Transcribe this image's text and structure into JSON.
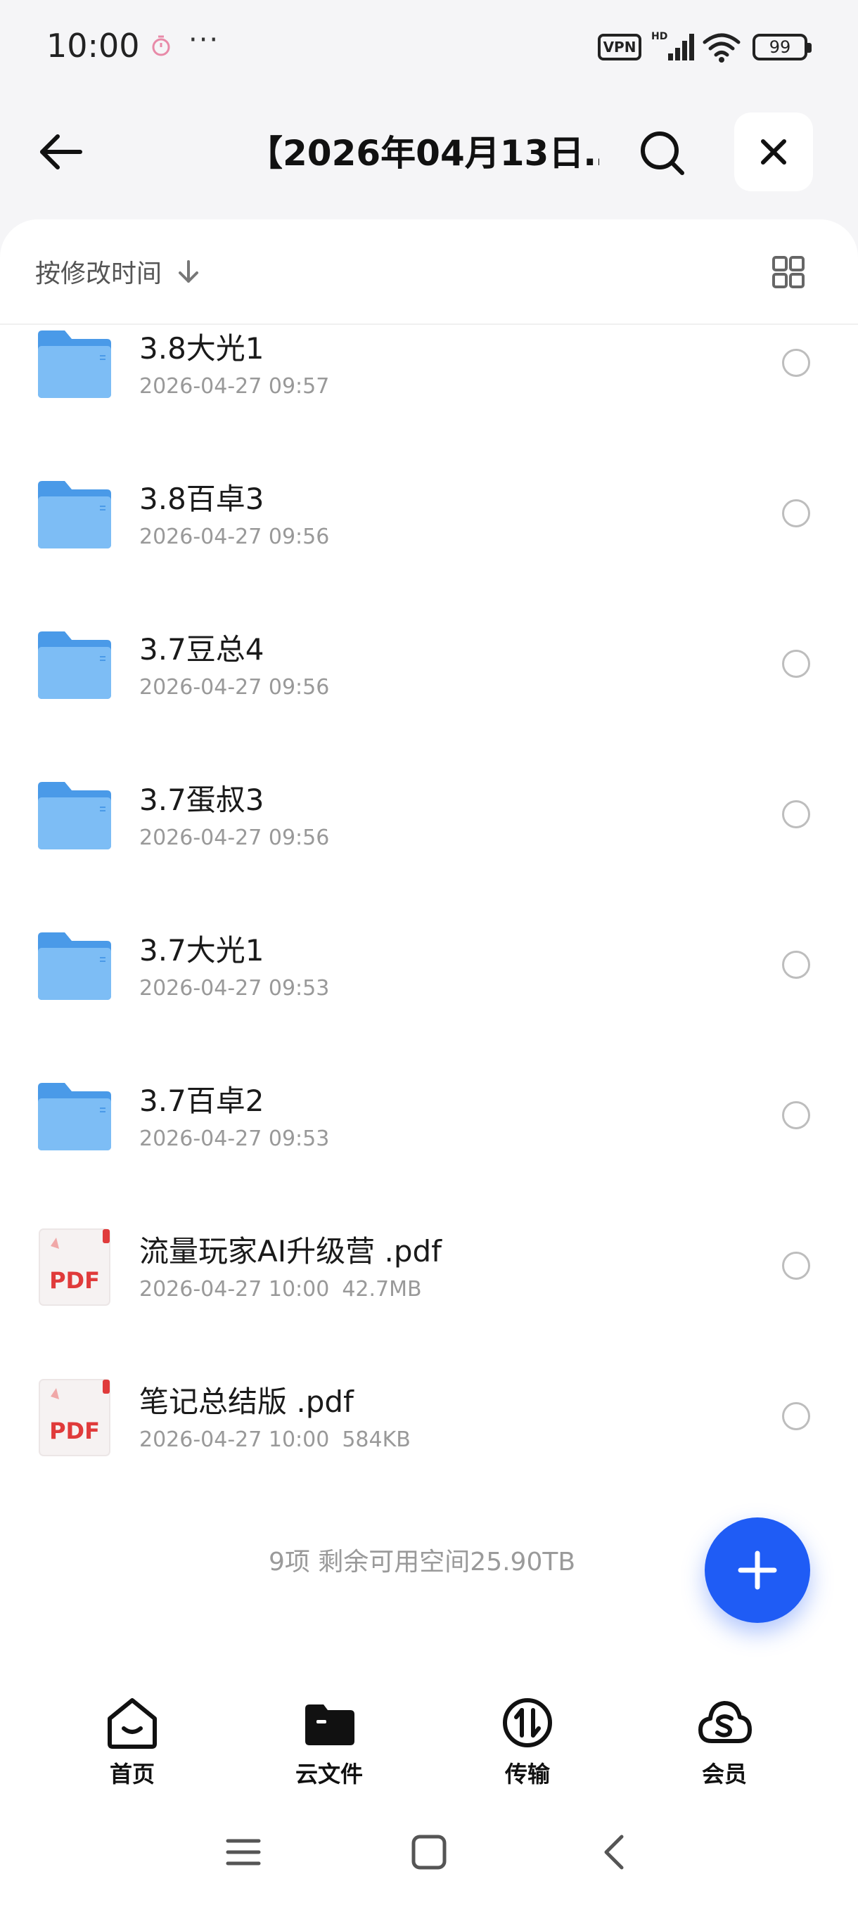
{
  "status_bar": {
    "time": "10:00",
    "dots": "···",
    "vpn_label": "VPN",
    "battery": "99",
    "icons": [
      "alarm-icon",
      "signal-icon",
      "wifi-icon",
      "battery-icon"
    ]
  },
  "header": {
    "title": "【2026年04月13日…",
    "icons": [
      "back-arrow-icon",
      "search-icon",
      "close-icon"
    ]
  },
  "sort": {
    "label": "按修改时间"
  },
  "files": [
    {
      "name": "3.8大光1",
      "date": "2026-04-27 09:57",
      "size": "",
      "type": "folder"
    },
    {
      "name": "3.8百卓3",
      "date": "2026-04-27 09:56",
      "size": "",
      "type": "folder"
    },
    {
      "name": "3.7豆总4",
      "date": "2026-04-27 09:56",
      "size": "",
      "type": "folder"
    },
    {
      "name": "3.7蛋叔3",
      "date": "2026-04-27 09:56",
      "size": "",
      "type": "folder"
    },
    {
      "name": "3.7大光1",
      "date": "2026-04-27 09:53",
      "size": "",
      "type": "folder"
    },
    {
      "name": "3.7百卓2",
      "date": "2026-04-27 09:53",
      "size": "",
      "type": "folder"
    },
    {
      "name": "流量玩家AI升级营 .pdf",
      "date": "2026-04-27 10:00",
      "size": "42.7MB",
      "type": "pdf"
    },
    {
      "name": "笔记总结版 .pdf",
      "date": "2026-04-27 10:00",
      "size": "584KB",
      "type": "pdf"
    }
  ],
  "pdf_badge": "PDF",
  "summary": "9项 剩余可用空间25.90TB",
  "tabs": [
    {
      "label": "首页",
      "icon": "home-icon"
    },
    {
      "label": "云文件",
      "icon": "cloud-folder-icon"
    },
    {
      "label": "传输",
      "icon": "transfer-icon"
    },
    {
      "label": "会员",
      "icon": "member-cloud-icon"
    }
  ],
  "colors": {
    "accent": "#1f5cf5",
    "folder": "#5aa9f0",
    "pdf_red": "#e03b3b"
  }
}
